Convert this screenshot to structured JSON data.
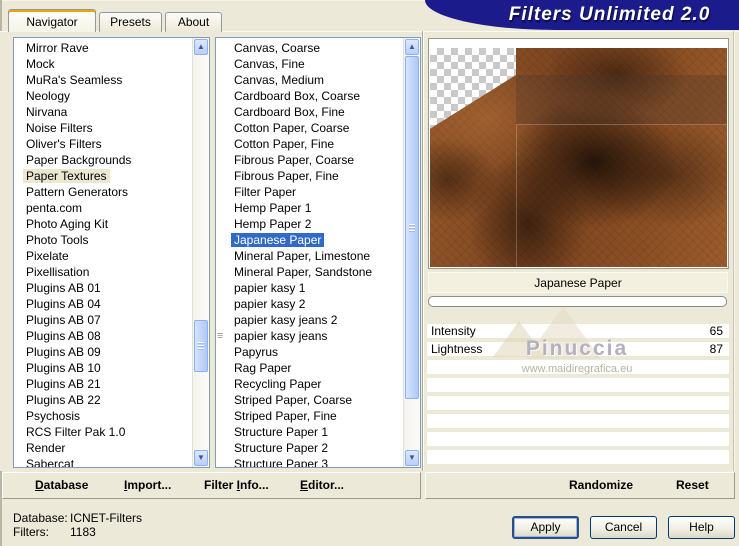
{
  "window": {
    "title": "Filters Unlimited 2.0"
  },
  "tabs": [
    {
      "label": "Navigator",
      "active": true
    },
    {
      "label": "Presets",
      "active": false
    },
    {
      "label": "About",
      "active": false
    }
  ],
  "category_list": {
    "items": [
      "Mirror Rave",
      "Mock",
      "MuRa's Seamless",
      "Neology",
      "Nirvana",
      "Noise Filters",
      "Oliver's Filters",
      "Paper Backgrounds",
      "Paper Textures",
      "Pattern Generators",
      "penta.com",
      "Photo Aging Kit",
      "Photo Tools",
      "Pixelate",
      "Pixellisation",
      "Plugins AB 01",
      "Plugins AB 04",
      "Plugins AB 07",
      "Plugins AB 08",
      "Plugins AB 09",
      "Plugins AB 10",
      "Plugins AB 21",
      "Plugins AB 22",
      "Psychosis",
      "RCS Filter Pak 1.0",
      "Render",
      "Sabercat"
    ],
    "selected": "Paper Textures"
  },
  "filter_list": {
    "items": [
      "Canvas, Coarse",
      "Canvas, Fine",
      "Canvas, Medium",
      "Cardboard Box, Coarse",
      "Cardboard Box, Fine",
      "Cotton Paper, Coarse",
      "Cotton Paper, Fine",
      "Fibrous Paper, Coarse",
      "Fibrous Paper, Fine",
      "Filter Paper",
      "Hemp Paper 1",
      "Hemp Paper 2",
      "Japanese Paper",
      "Mineral Paper, Limestone",
      "Mineral Paper, Sandstone",
      "papier kasy 1",
      "papier kasy 2",
      "papier kasy jeans 2",
      "papier kasy jeans",
      "Papyrus",
      "Rag Paper",
      "Recycling Paper",
      "Striped Paper, Coarse",
      "Striped Paper, Fine",
      "Structure Paper 1",
      "Structure Paper 2",
      "Structure Paper 3"
    ],
    "selected": "Japanese Paper",
    "grip_item": "papier kasy jeans"
  },
  "preview": {
    "filter_name": "Japanese Paper",
    "watermark_title": "Pinuccia",
    "watermark_url": "www.maidiregrafica.eu"
  },
  "params": [
    {
      "label": "Intensity",
      "value": "65"
    },
    {
      "label": "Lightness",
      "value": "87"
    }
  ],
  "toolbar": {
    "database": "Database",
    "import": "Import...",
    "filter_info": "Filter Info...",
    "editor": "Editor...",
    "randomize": "Randomize",
    "reset": "Reset"
  },
  "status": {
    "database_label": "Database:",
    "database_value": "ICNET-Filters",
    "filters_label": "Filters:",
    "filters_value": "1183"
  },
  "actions": {
    "apply": "Apply",
    "cancel": "Cancel",
    "help": "Help"
  },
  "colors": {
    "banner_navy": "#1b1b8c",
    "selection_blue": "#316ac5",
    "selection_tan": "#ebe7d0",
    "panel_beige": "#ece9d8",
    "tab_accent_orange": "#f0a500"
  }
}
